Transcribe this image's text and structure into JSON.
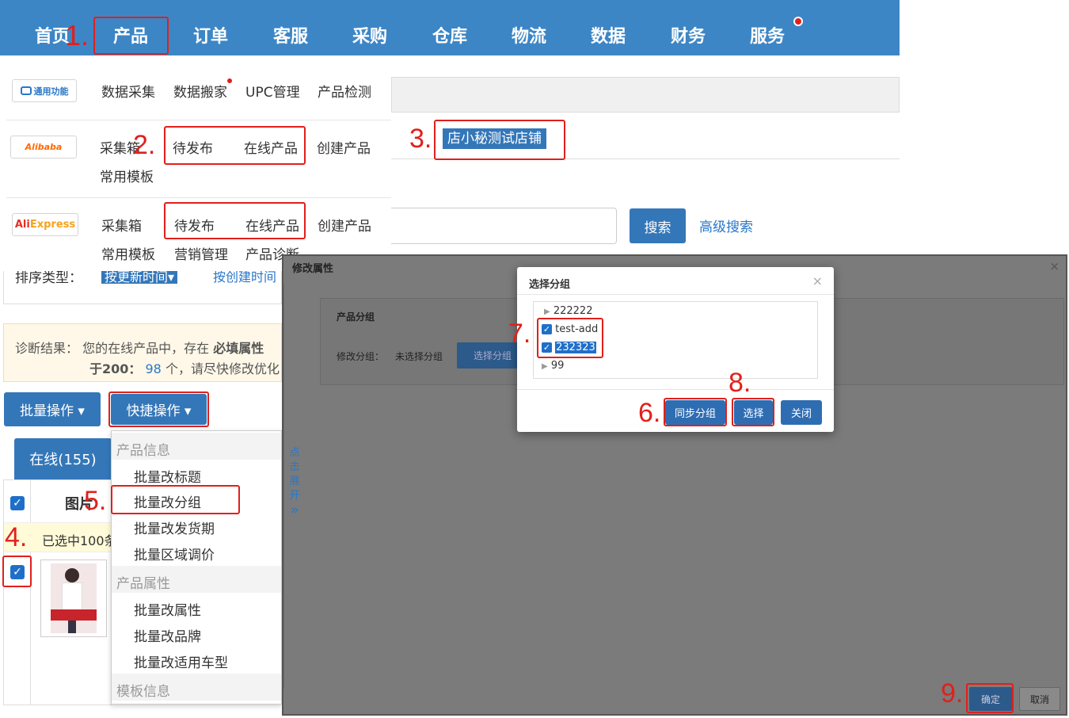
{
  "nav": {
    "items": [
      "首页",
      "产品",
      "订单",
      "客服",
      "采购",
      "仓库",
      "物流",
      "数据",
      "财务",
      "服务"
    ]
  },
  "steps": [
    "1.",
    "2.",
    "3.",
    "4.",
    "5.",
    "6.",
    "7.",
    "8.",
    "9."
  ],
  "general": {
    "logo": "通用功能",
    "items": [
      "数据采集",
      "数据搬家",
      "UPC管理",
      "产品检测"
    ]
  },
  "alibaba": {
    "logo": "Alibaba",
    "items": [
      "采集箱",
      "待发布",
      "在线产品",
      "创建产品"
    ],
    "row2": "常用模板"
  },
  "aliexpress": {
    "logo_red": "Ali",
    "logo_orange": "Express",
    "items": [
      "采集箱",
      "待发布",
      "在线产品",
      "创建产品"
    ],
    "row2": [
      "常用模板",
      "营销管理",
      "产品诊断"
    ]
  },
  "shop": "店小秘测试店铺",
  "search": {
    "button": "搜索",
    "advanced": "高级搜索"
  },
  "sort": {
    "label": "排序类型：",
    "opt1": "按更新时间▾",
    "opt2": "按创建时间"
  },
  "diag": {
    "prefix": "诊断结果：",
    "line1": "您的在线产品中，存在",
    "bold1": "必填属性",
    "line2a": "于200：",
    "count": "98",
    "line2b": "个，请尽快修改优化"
  },
  "buttons": {
    "batch": "批量操作 ▾",
    "quick": "快捷操作 ▾"
  },
  "tab_online": "在线(155)",
  "table": {
    "col_image": "图片",
    "selected": "已选中100条"
  },
  "dropdown": {
    "h1": "产品信息",
    "g1": [
      "批量改标题",
      "批量改分组",
      "批量改发货期",
      "批量区域调价"
    ],
    "h2": "产品属性",
    "g2": [
      "批量改属性",
      "批量改品牌",
      "批量改适用车型"
    ],
    "h3": "模板信息"
  },
  "modal": {
    "title": "修改属性",
    "side": [
      "点",
      "击",
      "展",
      "开"
    ],
    "group_title": "产品分组",
    "field_label": "修改分组：",
    "field_value": "未选择分组",
    "select_btn": "选择分组",
    "ok": "确定",
    "cancel": "取消"
  },
  "group_modal": {
    "title": "选择分组",
    "tree": [
      "222222",
      "test-add",
      "232323",
      "99"
    ],
    "btn_sync": "同步分组",
    "btn_select": "选择",
    "btn_close": "关闭"
  },
  "colors": {
    "nav": "#3d86c6",
    "accent": "#3477b9",
    "annotation": "#e0201c",
    "overlay": "#7b7b7b"
  }
}
